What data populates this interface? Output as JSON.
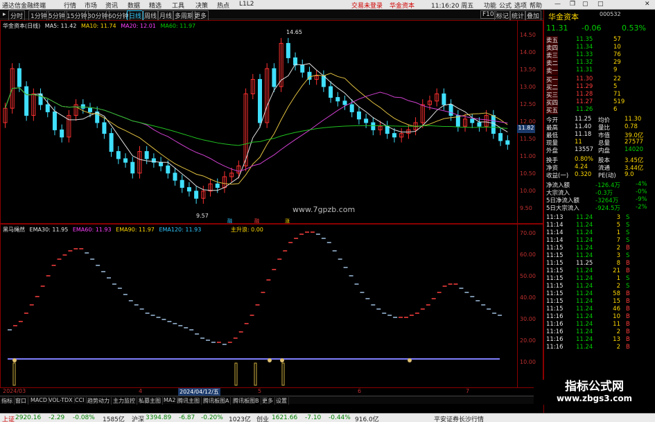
{
  "titlebar": {
    "app": "通达信金融终端",
    "menus": [
      "行情",
      "市场",
      "资讯",
      "数据",
      "精选",
      "工具",
      "决策",
      "热点",
      "L1L2"
    ],
    "trade_login": "交易未登录",
    "stock_name": "华金资本",
    "time": "11:16:20 周五",
    "right_menus": [
      "功能",
      "公式",
      "选项",
      "帮助"
    ]
  },
  "toolbar": {
    "periods": [
      "分时",
      "1分钟",
      "5分钟",
      "15分钟",
      "30分钟",
      "60分钟",
      "日线",
      "周线",
      "月线",
      "多周期",
      "更多"
    ],
    "active_period": "日线",
    "right_buttons": [
      "F10",
      "标记",
      "统计",
      "叠加",
      "画线",
      "返回"
    ]
  },
  "main_chart": {
    "stock": "华金资本(日线)",
    "ma5": "MA5: 11.42",
    "ma10": "MA10: 11.74",
    "ma20": "MA20: 12.01",
    "ma60": "MA60: 11.97",
    "high_label": "14.65",
    "low_label": "9.57",
    "price_tag": "11.82",
    "watermark": "www.7gpzb.com",
    "y_ticks": [
      "14.50",
      "14.00",
      "13.50",
      "13.00",
      "12.50",
      "12.00",
      "11.50",
      "11.00",
      "10.50",
      "10.00",
      "9.50"
    ],
    "markers": [
      "融",
      "融",
      "涨"
    ]
  },
  "indicator": {
    "name": "黑马绳然",
    "ema30": "EMA30: 11.95",
    "ema60": "EMA60: 11.93",
    "ema90": "EMA90: 11.97",
    "ema120": "EMA120: 11.93",
    "extra": "主升浪: 0.00",
    "y_ticks": [
      "70.00",
      "60.00",
      "50.00",
      "40.00",
      "30.00",
      "20.00",
      "10.00"
    ]
  },
  "dates": {
    "start": "2024/03",
    "ticks": [
      "4",
      "5",
      "6",
      "7"
    ],
    "cursor": "2024/04/12/五"
  },
  "indicator_tabs": [
    "指标",
    "窗口",
    "MACD",
    "VOL-TDX",
    "CCI",
    "趋势动力",
    "主力监控",
    "私募主图",
    "MA2",
    "腾讯主图",
    "腾讯板图A",
    "腾讯板图B",
    "更多",
    "设置"
  ],
  "right_panel": {
    "name": "华金资本",
    "code": "000532",
    "price": "11.31",
    "change": "-0.06",
    "pct": "0.53%",
    "asks": [
      {
        "label": "卖五",
        "price": "11.35",
        "vol": "57"
      },
      {
        "label": "卖四",
        "price": "11.34",
        "vol": "10"
      },
      {
        "label": "卖三",
        "price": "11.33",
        "vol": "76"
      },
      {
        "label": "卖二",
        "price": "11.32",
        "vol": "29"
      },
      {
        "label": "卖一",
        "price": "11.31",
        "vol": "9"
      }
    ],
    "bids": [
      {
        "label": "买一",
        "price": "11.30",
        "vol": "22"
      },
      {
        "label": "买二",
        "price": "11.29",
        "vol": "5"
      },
      {
        "label": "买三",
        "price": "11.28",
        "vol": "71"
      },
      {
        "label": "买四",
        "price": "11.27",
        "vol": "519"
      },
      {
        "label": "买五",
        "price": "11.26",
        "vol": "6"
      }
    ],
    "stats": [
      {
        "l1": "今开",
        "v1": "11.25",
        "l2": "均价",
        "v2": "11.30"
      },
      {
        "l1": "最高",
        "v1": "11.40",
        "l2": "量比",
        "v2": "0.78"
      },
      {
        "l1": "最低",
        "v1": "11.18",
        "l2": "市值",
        "v2": "39.0亿"
      },
      {
        "l1": "现量",
        "v1": "11",
        "l2": "总量",
        "v2": "27577"
      },
      {
        "l1": "外盘",
        "v1": "13557",
        "l2": "内盘",
        "v2": "14020"
      }
    ],
    "fund": [
      {
        "l1": "换手",
        "v1": "0.80%",
        "l2": "股本",
        "v2": "3.45亿"
      },
      {
        "l1": "净资",
        "v1": "4.24",
        "l2": "流通",
        "v2": "3.44亿"
      },
      {
        "l1": "收益(一)",
        "v1": "0.320",
        "l2": "PE(动)",
        "v2": "9.0"
      }
    ],
    "flows": [
      {
        "label": "净流入额",
        "value": "-126.4万",
        "pct": "-4%"
      },
      {
        "label": "大宗流入",
        "value": "-0.3万",
        "pct": "-0%"
      },
      {
        "label": "5日净流入额",
        "value": "-3264万",
        "pct": "-9%"
      },
      {
        "label": "5日大宗流入",
        "value": "-924.5万",
        "pct": "-2%"
      }
    ],
    "ticks": [
      {
        "t": "11:13",
        "p": "11.24",
        "v": "3",
        "d": "S"
      },
      {
        "t": "11:14",
        "p": "11.24",
        "v": "5",
        "d": "S"
      },
      {
        "t": "11:14",
        "p": "11.24",
        "v": "1",
        "d": "S"
      },
      {
        "t": "11:14",
        "p": "11.24",
        "v": "7",
        "d": "S"
      },
      {
        "t": "11:15",
        "p": "11.24",
        "v": "2",
        "d": "B"
      },
      {
        "t": "11:15",
        "p": "11.24",
        "v": "3",
        "d": "S"
      },
      {
        "t": "11:15",
        "p": "11.25",
        "v": "8",
        "d": "B"
      },
      {
        "t": "11:15",
        "p": "11.24",
        "v": "21",
        "d": "B"
      },
      {
        "t": "11:15",
        "p": "11.24",
        "v": "1",
        "d": "S"
      },
      {
        "t": "11:15",
        "p": "11.24",
        "v": "2",
        "d": "S"
      },
      {
        "t": "11:15",
        "p": "11.24",
        "v": "58",
        "d": "B"
      },
      {
        "t": "11:15",
        "p": "11.24",
        "v": "15",
        "d": "B"
      },
      {
        "t": "11:15",
        "p": "11.24",
        "v": "46",
        "d": "B"
      },
      {
        "t": "11:16",
        "p": "11.24",
        "v": "10",
        "d": "B"
      },
      {
        "t": "11:16",
        "p": "11.24",
        "v": "11",
        "d": "B"
      },
      {
        "t": "11:16",
        "p": "11.24",
        "v": "2",
        "d": "B"
      },
      {
        "t": "11:16",
        "p": "11.24",
        "v": "13",
        "d": "B"
      },
      {
        "t": "11:16",
        "p": "11.24",
        "v": "2",
        "d": "B"
      }
    ]
  },
  "statusbar": {
    "sh_label": "上证",
    "sh_value": "2920.16",
    "sh_chg": "-2.29",
    "sh_pct": "-0.08%",
    "sh_amt": "1585亿",
    "sz_label": "沪深",
    "sz_value": "3394.89",
    "sz_chg": "-6.87",
    "sz_pct": "-0.20%",
    "sz_amt": "1023亿",
    "cy_label": "创业",
    "cy_value": "1621.66",
    "cy_chg": "-7.10",
    "cy_pct": "-0.44%",
    "cy_amt": "916.0亿",
    "broker": "平安证券长沙行情"
  },
  "watermark": {
    "line1": "指标公式网",
    "line2": "www.zbgs3.com"
  }
}
